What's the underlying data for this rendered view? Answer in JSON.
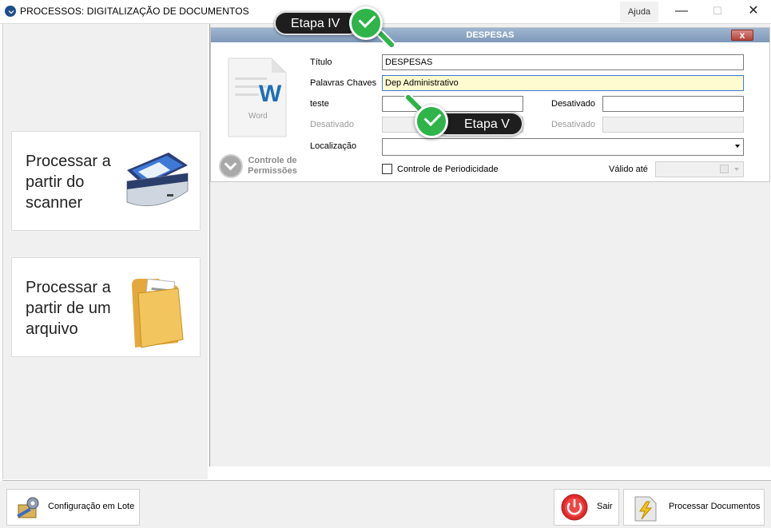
{
  "window": {
    "title": "PROCESSOS: DIGITALIZAÇÃO DE DOCUMENTOS",
    "help_label": "Ajuda",
    "minimize_glyph": "—",
    "maximize_glyph": "☐",
    "close_glyph": "✕"
  },
  "sidebar": {
    "scanner_label": "Processar a partir do scanner",
    "file_label": "Processar a partir de um arquivo"
  },
  "document": {
    "header_title": "DESPESAS",
    "close_glyph": "x",
    "icon_letter": "W",
    "icon_caption": "Word",
    "permissions_label": "Controle de Permissões",
    "fields": {
      "titulo_label": "Título",
      "titulo_value": "DESPESAS",
      "palavras_label": "Palavras Chaves",
      "palavras_value": "Dep Administrativo",
      "teste_label": "teste",
      "teste_value": "",
      "desativado1_label": "Desativado",
      "desativado1_value": "",
      "desativado2_label": "Desativado",
      "desativado3_label": "Desativado",
      "localizacao_label": "Localização",
      "localizacao_value": "",
      "periodicidade_label": "Controle de Periodicidade",
      "valido_label": "Válido até"
    }
  },
  "callouts": {
    "etapa4": "Etapa IV",
    "etapa5": "Etapa V"
  },
  "footer": {
    "batch_config_label": "Configuração em Lote",
    "exit_label": "Sair",
    "process_label": "Processar Documentos"
  },
  "colors": {
    "header_blue": "#8aa3c2",
    "highlight_field": "#fffbd0",
    "check_green": "#2fb44a"
  }
}
